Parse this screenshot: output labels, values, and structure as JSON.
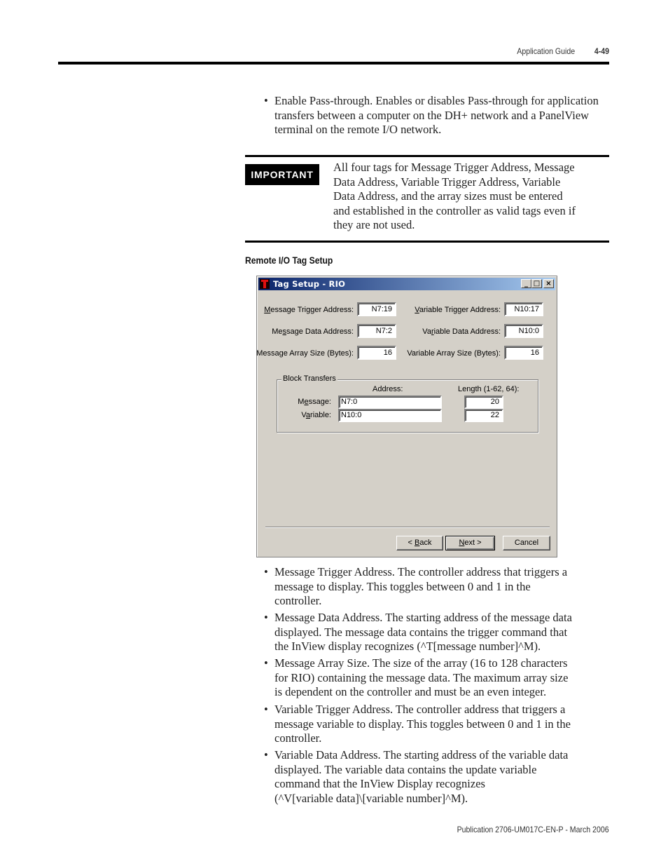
{
  "header": {
    "section": "Application Guide",
    "page_number": "4-49"
  },
  "intro_bullet": "Enable Pass-through. Enables or disables Pass-through for application transfers between a computer on the DH+ network and a PanelView terminal on the remote I/O network.",
  "important": {
    "badge": "IMPORTANT",
    "lines": [
      "All four tags for Message Trigger Address, Message",
      "Data Address, Variable Trigger Address, Variable",
      "Data Address, and the array sizes must be entered",
      "and established in the controller as valid tags even if",
      "they are not used."
    ]
  },
  "section_title": "Remote I/O Tag Setup",
  "dialog": {
    "title": "Tag Setup - RIO",
    "title_buttons": {
      "minimize": "_",
      "maximize": "□",
      "close": "×"
    },
    "left_fields": [
      {
        "label_u": "M",
        "label_rest": "essage Trigger Address:",
        "value": "N7:19"
      },
      {
        "label_pre": "Me",
        "label_u": "s",
        "label_rest": "sage Data Address:",
        "value": "N7:2"
      },
      {
        "label_full": "Message Array Size (Bytes):",
        "value": "16"
      }
    ],
    "right_fields": [
      {
        "label_u": "V",
        "label_rest": "ariable Trigger Address:",
        "value": "N10:17"
      },
      {
        "label_pre": "Va",
        "label_u": "r",
        "label_rest": "iable Data Address:",
        "value": "N10:0"
      },
      {
        "label_full": "Variable Array Size (Bytes):",
        "value": "16"
      }
    ],
    "block_transfers": {
      "title": "Block Transfers",
      "address_header": "Address:",
      "length_header": "Length (1-62, 64):",
      "rows": [
        {
          "label_pre": "M",
          "label_u": "e",
          "label_rest": "ssage:",
          "address": "N7:0",
          "length": "20"
        },
        {
          "label_pre": "V",
          "label_u": "a",
          "label_rest": "riable:",
          "address": "N10:0",
          "length": "22"
        }
      ]
    },
    "buttons": {
      "back_pre": "< ",
      "back_u": "B",
      "back_rest": "ack",
      "next_u": "N",
      "next_rest": "ext >",
      "cancel": "Cancel"
    }
  },
  "bullets": [
    {
      "lines": [
        "Message Trigger Address. The controller address that triggers a",
        "message to display. This toggles between 0 and 1 in the",
        "controller."
      ]
    },
    {
      "lines": [
        "Message Data Address. The starting address of the message data",
        "displayed. The message data contains the trigger command that",
        "the InView display recognizes (^T[message number]^M)."
      ]
    },
    {
      "lines": [
        "Message Array Size. The size of the array (16 to 128 characters",
        "for RIO) containing the message data. The maximum array size",
        "is dependent on the controller and must be an even integer."
      ]
    },
    {
      "lines": [
        "Variable Trigger Address. The controller address that triggers a",
        "message variable to display. This toggles between 0 and 1 in the",
        "controller."
      ]
    },
    {
      "lines": [
        "Variable Data Address. The starting address of the variable data",
        "displayed. The variable data contains the update variable",
        "command that the InView Display recognizes",
        "(^V[variable data]\\[variable number]^M)."
      ]
    }
  ],
  "footer": "Publication 2706-UM017C-EN-P - March 2006",
  "bullet_glyph": "•"
}
